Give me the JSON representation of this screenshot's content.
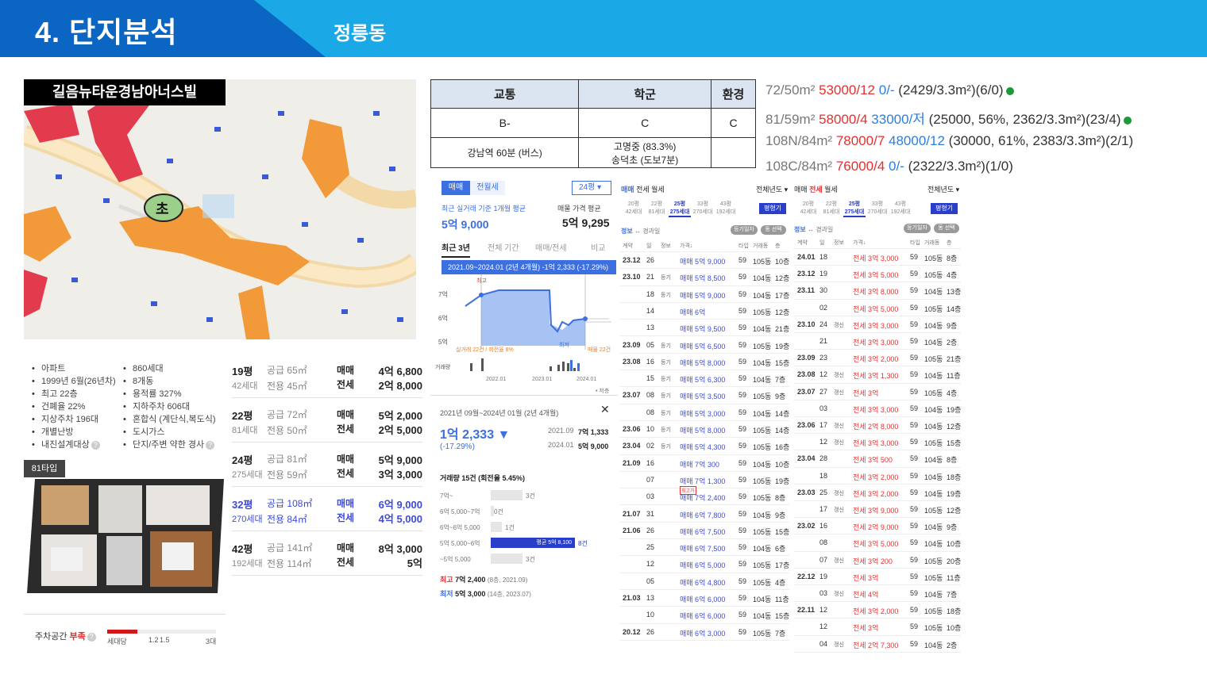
{
  "header": {
    "title": "4. 단지분석",
    "subtitle": "정릉동"
  },
  "map": {
    "title": "길음뉴타운경남아너스빌",
    "school_marker": "초"
  },
  "info": {
    "left": [
      "아파트",
      "1999년 6월(26년차)",
      "최고 22층",
      "건폐율 22%",
      "지상주차 196대",
      "개별난방",
      "내진설계대상"
    ],
    "right": [
      "860세대",
      "8개동",
      "용적률 327%",
      "지하주차 606대",
      "혼합식 (계단식,복도식)",
      "도시가스",
      "단지/주변 약한 경사"
    ]
  },
  "type_label": "81타입",
  "parking": {
    "label": "주차공간",
    "status": "부족",
    "unit": "세대당",
    "ticks": [
      "1.2",
      "1.5",
      "3대"
    ],
    "ratio": 0.28
  },
  "pyeong": [
    {
      "py": "19평",
      "hh": "42세대",
      "sup": "공급 65㎡",
      "exc": "전용 45㎡",
      "k1": "매매",
      "k2": "전세",
      "p1": "4억 6,800",
      "p2": "2억 8,000",
      "hl": false
    },
    {
      "py": "22평",
      "hh": "81세대",
      "sup": "공급 72㎡",
      "exc": "전용 50㎡",
      "k1": "매매",
      "k2": "전세",
      "p1": "5억 2,000",
      "p2": "2억 5,000",
      "hl": false
    },
    {
      "py": "24평",
      "hh": "275세대",
      "sup": "공급 81㎡",
      "exc": "전용 59㎡",
      "k1": "매매",
      "k2": "전세",
      "p1": "5억 9,000",
      "p2": "3억 3,000",
      "hl": false
    },
    {
      "py": "32평",
      "hh": "270세대",
      "sup": "공급 108㎡",
      "exc": "전용 84㎡",
      "k1": "매매",
      "k2": "전세",
      "p1": "6억 9,000",
      "p2": "4억 5,000",
      "hl": true
    },
    {
      "py": "42평",
      "hh": "192세대",
      "sup": "공급 141㎡",
      "exc": "전용 114㎡",
      "k1": "매매",
      "k2": "전세",
      "p1": "8억 3,000",
      "p2": "5억",
      "hl": false
    }
  ],
  "score": {
    "headers": [
      "교통",
      "학군",
      "환경"
    ],
    "grades": [
      "B-",
      "C",
      "C"
    ],
    "detail": [
      "강남역 60분 (버스)",
      "고명중 (83.3%)",
      "송덕초 (도보7분)",
      ""
    ]
  },
  "summary": [
    {
      "type": "72/50m²",
      "sale": "53000/12",
      "rent": "0/-",
      "rest": "(2429/3.3m²)(6/0)",
      "dot": true
    },
    {
      "type": "81/59m²",
      "sale": "58000/4",
      "rent": "33000/저",
      "rest": "(25000, 56%, 2362/3.3m²)(23/4)",
      "dot": true
    },
    {
      "type": "108N/84m²",
      "sale": "78000/7",
      "rent": "48000/12",
      "rest": "(30000, 61%, 2383/3.3m²)(2/1)",
      "dot": false
    },
    {
      "type": "108C/84m²",
      "sale": "76000/4",
      "rent": "0/-",
      "rest": "(2322/3.3m²)(1/0)",
      "dot": false
    }
  ],
  "price": {
    "tabs": [
      "매매",
      "전월세"
    ],
    "py_select": "24평",
    "avg_label": "최근 실거래 기준 1개월 평균",
    "avg": "5억 9,000",
    "ask_label": "매물 가격 평균",
    "ask": "5억 9,295",
    "ptabs": [
      "최근 3년",
      "전체 기간",
      "매매/전세",
      "비교"
    ],
    "range_banner": "2021.09~2024.01 (2년 4개월) -1억 2,333 (-17.29%)",
    "ylabels": [
      "7억",
      "6억",
      "5억"
    ],
    "xlabels": [
      "2022.01",
      "2023.01",
      "2024.01"
    ],
    "high_tag": "최고",
    "low_tag": "최저",
    "sub_left": "실거래 22건 / 회전율 8%",
    "sub_right": "매물 22건",
    "vol_label": "거래량",
    "legend": "저층",
    "detail": {
      "period": "2021년 09월~2024년 01월 (2년 4개월)",
      "change": "1억 2,333",
      "pct": "(-17.29%)",
      "from_date": "2021.09",
      "from_val": "7억 1,333",
      "to_date": "2024.01",
      "to_val": "5억 9,000",
      "vol_title": "거래량 15건 (회전율 5.45%)",
      "bars": [
        {
          "label": "7억~",
          "val": "3건",
          "frac": 0.2,
          "hl": false
        },
        {
          "label": "6억 5,000~7억",
          "val": "0건",
          "frac": 0,
          "hl": false
        },
        {
          "label": "6억~6억 5,000",
          "val": "1건",
          "frac": 0.07,
          "hl": false
        },
        {
          "label": "5억 5,000~6억",
          "val": "8건",
          "frac": 0.53,
          "hl": true,
          "note": "평균 5억 8,100"
        },
        {
          "label": "~5억 5,000",
          "val": "3건",
          "frac": 0.2,
          "hl": false
        }
      ],
      "max_label": "최고",
      "max_val": "7억 2,400",
      "max_note": "(8층, 2021.09)",
      "min_label": "최저",
      "min_val": "5억 3,000",
      "min_note": "(14층, 2023.07)"
    }
  },
  "sale_list": {
    "tabs": [
      "매매",
      "전세",
      "월세"
    ],
    "year_filter": "전체년도",
    "sizes": [
      {
        "p": "20평",
        "h": "42세대"
      },
      {
        "p": "22평",
        "h": "81세대"
      },
      {
        "p": "25평",
        "h": "275세대"
      },
      {
        "p": "33평",
        "h": "270세대"
      },
      {
        "p": "43평",
        "h": "192세대"
      }
    ],
    "btn": "평형기",
    "info": "정보",
    "info2": "↔ 경과일",
    "chip1": "등기일자",
    "chip2": "동 선택",
    "cols": [
      "계약",
      "일",
      "정보",
      "가격↓",
      "타입",
      "거래동",
      "층"
    ],
    "rows": [
      [
        "23.12",
        "26",
        "",
        "매매 5억 9,000",
        "59",
        "105동",
        "10층"
      ],
      [
        "23.10",
        "21",
        "등기",
        "매매 5억 8,500",
        "59",
        "104동",
        "12층"
      ],
      [
        "",
        "18",
        "등기",
        "매매 5억 9,000",
        "59",
        "104동",
        "17층"
      ],
      [
        "",
        "14",
        "",
        "매매 6억",
        "59",
        "105동",
        "12층"
      ],
      [
        "",
        "13",
        "",
        "매매 5억 9,500",
        "59",
        "104동",
        "21층"
      ],
      [
        "23.09",
        "05",
        "등기",
        "매매 5억 6,500",
        "59",
        "105동",
        "19층"
      ],
      [
        "23.08",
        "16",
        "등기",
        "매매 5억 8,000",
        "59",
        "104동",
        "15층"
      ],
      [
        "",
        "15",
        "등기",
        "매매 5억 6,300",
        "59",
        "104동",
        "7층"
      ],
      [
        "23.07",
        "08",
        "등기",
        "매매 5억 3,500",
        "59",
        "105동",
        "9층"
      ],
      [
        "",
        "08",
        "등기",
        "매매 5억 3,000",
        "59",
        "104동",
        "14층"
      ],
      [
        "23.06",
        "10",
        "등기",
        "매매 5억 8,000",
        "59",
        "105동",
        "14층"
      ],
      [
        "23.04",
        "02",
        "등기",
        "매매 5억 4,300",
        "59",
        "105동",
        "16층"
      ],
      [
        "21.09",
        "16",
        "",
        "매매 7억 300",
        "59",
        "104동",
        "10층"
      ],
      [
        "",
        "07",
        "",
        "매매 7억 1,300",
        "59",
        "105동",
        "19층"
      ],
      [
        "",
        "03",
        "",
        "매매 7억 2,400",
        "59",
        "105동",
        "8층"
      ],
      [
        "21.07",
        "31",
        "",
        "매매 6억 7,800",
        "59",
        "104동",
        "9층"
      ],
      [
        "21.06",
        "26",
        "",
        "매매 6억 7,500",
        "59",
        "105동",
        "15층"
      ],
      [
        "",
        "25",
        "",
        "매매 6억 7,500",
        "59",
        "104동",
        "6층"
      ],
      [
        "",
        "12",
        "",
        "매매 6억 5,000",
        "59",
        "105동",
        "17층"
      ],
      [
        "",
        "05",
        "",
        "매매 6억 4,800",
        "59",
        "105동",
        "4층"
      ],
      [
        "21.03",
        "13",
        "",
        "매매 6억 6,000",
        "59",
        "104동",
        "11층"
      ],
      [
        "",
        "10",
        "",
        "매매 6억 6,000",
        "59",
        "104동",
        "15층"
      ],
      [
        "20.12",
        "26",
        "",
        "매매 6억 3,000",
        "59",
        "105동",
        "7층"
      ]
    ],
    "max_tag": "최고가"
  },
  "rent_list": {
    "rows": [
      [
        "24.01",
        "18",
        "",
        "전세 3억 3,000",
        "59",
        "105동",
        "8층"
      ],
      [
        "23.12",
        "19",
        "",
        "전세 3억 5,000",
        "59",
        "105동",
        "4층"
      ],
      [
        "23.11",
        "30",
        "",
        "전세 3억 8,000",
        "59",
        "104동",
        "13층"
      ],
      [
        "",
        "02",
        "",
        "전세 3억 5,000",
        "59",
        "105동",
        "14층"
      ],
      [
        "23.10",
        "24",
        "갱신",
        "전세 3억 3,000",
        "59",
        "104동",
        "9층"
      ],
      [
        "",
        "21",
        "",
        "전세 3억 3,000",
        "59",
        "104동",
        "2층"
      ],
      [
        "23.09",
        "23",
        "",
        "전세 3억 2,000",
        "59",
        "105동",
        "21층"
      ],
      [
        "23.08",
        "12",
        "갱신",
        "전세 3억 1,300",
        "59",
        "104동",
        "11층"
      ],
      [
        "23.07",
        "27",
        "갱신",
        "전세 3억",
        "59",
        "105동",
        "4층"
      ],
      [
        "",
        "03",
        "",
        "전세 3억 3,000",
        "59",
        "104동",
        "19층"
      ],
      [
        "23.06",
        "17",
        "갱신",
        "전세 2억 8,000",
        "59",
        "104동",
        "12층"
      ],
      [
        "",
        "12",
        "갱신",
        "전세 3억 3,000",
        "59",
        "105동",
        "15층"
      ],
      [
        "23.04",
        "28",
        "",
        "전세 3억 500",
        "59",
        "104동",
        "8층"
      ],
      [
        "",
        "18",
        "",
        "전세 3억 2,000",
        "59",
        "104동",
        "18층"
      ],
      [
        "23.03",
        "25",
        "갱신",
        "전세 3억 2,000",
        "59",
        "104동",
        "19층"
      ],
      [
        "",
        "17",
        "갱신",
        "전세 3억 9,000",
        "59",
        "105동",
        "12층"
      ],
      [
        "23.02",
        "16",
        "",
        "전세 2억 9,000",
        "59",
        "104동",
        "9층"
      ],
      [
        "",
        "08",
        "",
        "전세 3억 5,000",
        "59",
        "104동",
        "10층"
      ],
      [
        "",
        "07",
        "갱신",
        "전세 3억 200",
        "59",
        "105동",
        "20층"
      ],
      [
        "22.12",
        "19",
        "",
        "전세 3억",
        "59",
        "105동",
        "11층"
      ],
      [
        "",
        "03",
        "갱신",
        "전세 4억",
        "59",
        "104동",
        "7층"
      ],
      [
        "22.11",
        "12",
        "",
        "전세 3억 2,000",
        "59",
        "105동",
        "18층"
      ],
      [
        "",
        "12",
        "",
        "전세 3억",
        "59",
        "105동",
        "10층"
      ],
      [
        "",
        "04",
        "갱신",
        "전세 2억 7,300",
        "59",
        "104동",
        "2층"
      ]
    ]
  }
}
